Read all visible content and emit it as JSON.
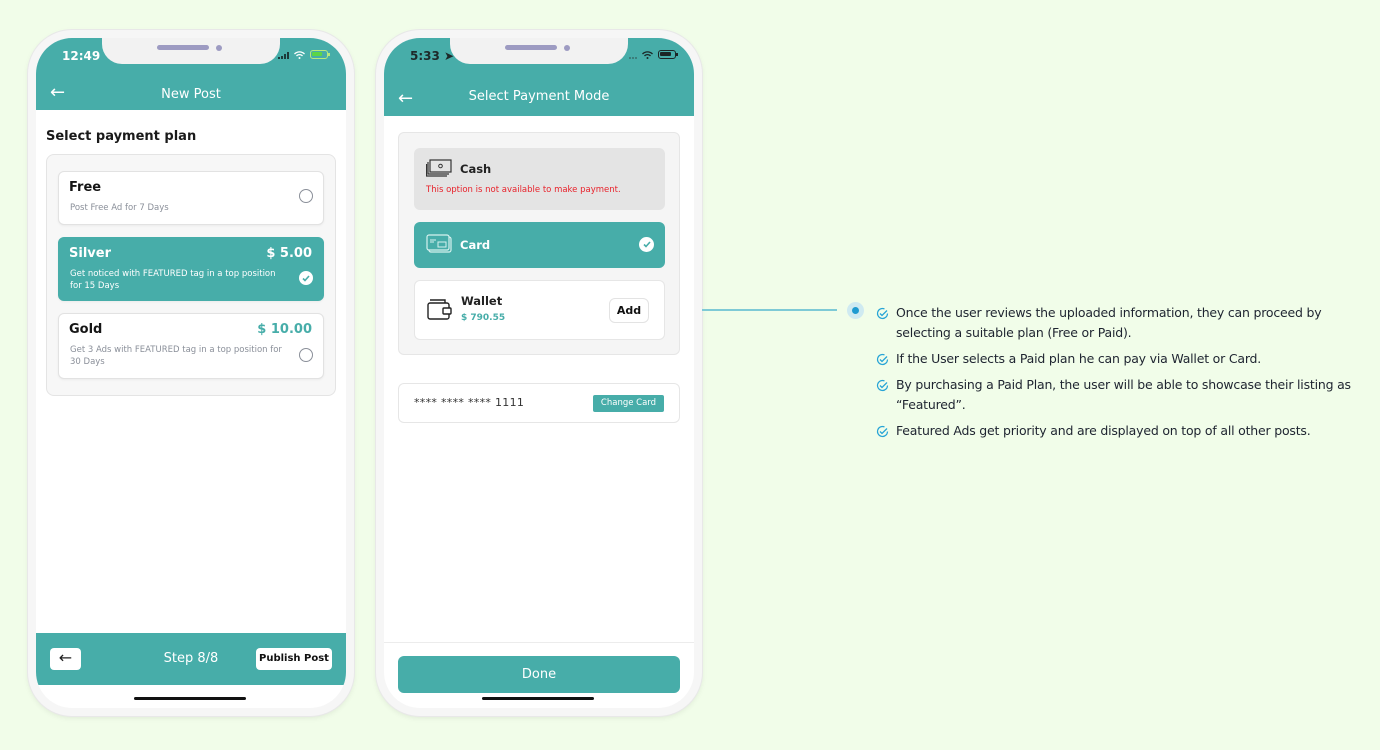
{
  "screen1": {
    "status_time": "12:49",
    "battery_level": 0.55,
    "title": "New Post",
    "heading": "Select payment plan",
    "plans": [
      {
        "name": "Free",
        "price": "",
        "desc": "Post Free Ad for 7 Days",
        "selected": false
      },
      {
        "name": "Silver",
        "price": "$ 5.00",
        "desc": "Get noticed with FEATURED tag in a top position for 15 Days",
        "selected": true
      },
      {
        "name": "Gold",
        "price": "$ 10.00",
        "desc": "Get 3 Ads with FEATURED tag in a top position for 30 Days",
        "selected": false
      }
    ],
    "footer": {
      "back": "←",
      "step": "Step 8/8",
      "publish": "Publish Post"
    }
  },
  "screen2": {
    "status_time": "5:33",
    "battery_level": 0.75,
    "title": "Select Payment Mode",
    "modes": {
      "cash": {
        "label": "Cash",
        "warning": "This option is not available to make payment."
      },
      "card": {
        "label": "Card",
        "selected": true
      },
      "wallet": {
        "label": "Wallet",
        "balance": "$ 790.55",
        "add": "Add"
      }
    },
    "card_number": "**** **** **** 1111",
    "change_card": "Change Card",
    "done": "Done"
  },
  "annotation": {
    "notes": [
      "Once the user reviews the uploaded information, they can proceed by selecting a suitable plan (Free or Paid).",
      "If the User selects a Paid plan he can pay via Wallet or Card.",
      "By purchasing a Paid Plan, the user will be able to showcase their listing as “Featured”.",
      "Featured Ads get priority and are displayed on top of all other posts."
    ]
  },
  "colors": {
    "primary": "#47ada9",
    "warning": "#e8232c",
    "background": "#f1fde9",
    "accent_blue": "#1f9bd0"
  },
  "icons": {
    "back": "arrow-left-icon",
    "check": "check-circle-icon",
    "radio": "radio-empty-icon",
    "cash": "cash-icon",
    "card": "credit-card-icon",
    "wallet": "wallet-icon"
  }
}
